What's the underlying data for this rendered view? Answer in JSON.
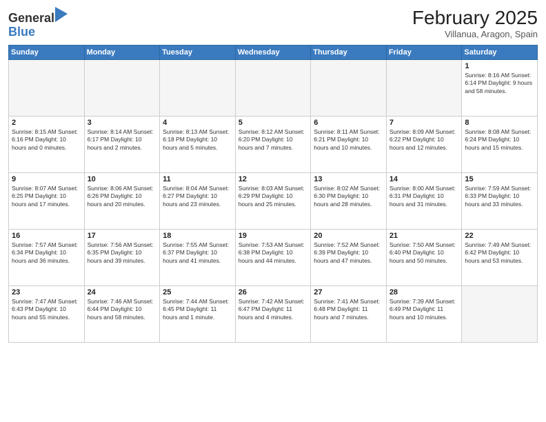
{
  "header": {
    "logo_general": "General",
    "logo_blue": "Blue",
    "month_title": "February 2025",
    "subtitle": "Villanua, Aragon, Spain"
  },
  "weekdays": [
    "Sunday",
    "Monday",
    "Tuesday",
    "Wednesday",
    "Thursday",
    "Friday",
    "Saturday"
  ],
  "weeks": [
    [
      {
        "day": "",
        "info": ""
      },
      {
        "day": "",
        "info": ""
      },
      {
        "day": "",
        "info": ""
      },
      {
        "day": "",
        "info": ""
      },
      {
        "day": "",
        "info": ""
      },
      {
        "day": "",
        "info": ""
      },
      {
        "day": "1",
        "info": "Sunrise: 8:16 AM\nSunset: 6:14 PM\nDaylight: 9 hours\nand 58 minutes."
      }
    ],
    [
      {
        "day": "2",
        "info": "Sunrise: 8:15 AM\nSunset: 6:16 PM\nDaylight: 10 hours\nand 0 minutes."
      },
      {
        "day": "3",
        "info": "Sunrise: 8:14 AM\nSunset: 6:17 PM\nDaylight: 10 hours\nand 2 minutes."
      },
      {
        "day": "4",
        "info": "Sunrise: 8:13 AM\nSunset: 6:18 PM\nDaylight: 10 hours\nand 5 minutes."
      },
      {
        "day": "5",
        "info": "Sunrise: 8:12 AM\nSunset: 6:20 PM\nDaylight: 10 hours\nand 7 minutes."
      },
      {
        "day": "6",
        "info": "Sunrise: 8:11 AM\nSunset: 6:21 PM\nDaylight: 10 hours\nand 10 minutes."
      },
      {
        "day": "7",
        "info": "Sunrise: 8:09 AM\nSunset: 6:22 PM\nDaylight: 10 hours\nand 12 minutes."
      },
      {
        "day": "8",
        "info": "Sunrise: 8:08 AM\nSunset: 6:24 PM\nDaylight: 10 hours\nand 15 minutes."
      }
    ],
    [
      {
        "day": "9",
        "info": "Sunrise: 8:07 AM\nSunset: 6:25 PM\nDaylight: 10 hours\nand 17 minutes."
      },
      {
        "day": "10",
        "info": "Sunrise: 8:06 AM\nSunset: 6:26 PM\nDaylight: 10 hours\nand 20 minutes."
      },
      {
        "day": "11",
        "info": "Sunrise: 8:04 AM\nSunset: 6:27 PM\nDaylight: 10 hours\nand 23 minutes."
      },
      {
        "day": "12",
        "info": "Sunrise: 8:03 AM\nSunset: 6:29 PM\nDaylight: 10 hours\nand 25 minutes."
      },
      {
        "day": "13",
        "info": "Sunrise: 8:02 AM\nSunset: 6:30 PM\nDaylight: 10 hours\nand 28 minutes."
      },
      {
        "day": "14",
        "info": "Sunrise: 8:00 AM\nSunset: 6:31 PM\nDaylight: 10 hours\nand 31 minutes."
      },
      {
        "day": "15",
        "info": "Sunrise: 7:59 AM\nSunset: 6:33 PM\nDaylight: 10 hours\nand 33 minutes."
      }
    ],
    [
      {
        "day": "16",
        "info": "Sunrise: 7:57 AM\nSunset: 6:34 PM\nDaylight: 10 hours\nand 36 minutes."
      },
      {
        "day": "17",
        "info": "Sunrise: 7:56 AM\nSunset: 6:35 PM\nDaylight: 10 hours\nand 39 minutes."
      },
      {
        "day": "18",
        "info": "Sunrise: 7:55 AM\nSunset: 6:37 PM\nDaylight: 10 hours\nand 41 minutes."
      },
      {
        "day": "19",
        "info": "Sunrise: 7:53 AM\nSunset: 6:38 PM\nDaylight: 10 hours\nand 44 minutes."
      },
      {
        "day": "20",
        "info": "Sunrise: 7:52 AM\nSunset: 6:39 PM\nDaylight: 10 hours\nand 47 minutes."
      },
      {
        "day": "21",
        "info": "Sunrise: 7:50 AM\nSunset: 6:40 PM\nDaylight: 10 hours\nand 50 minutes."
      },
      {
        "day": "22",
        "info": "Sunrise: 7:49 AM\nSunset: 6:42 PM\nDaylight: 10 hours\nand 53 minutes."
      }
    ],
    [
      {
        "day": "23",
        "info": "Sunrise: 7:47 AM\nSunset: 6:43 PM\nDaylight: 10 hours\nand 55 minutes."
      },
      {
        "day": "24",
        "info": "Sunrise: 7:46 AM\nSunset: 6:44 PM\nDaylight: 10 hours\nand 58 minutes."
      },
      {
        "day": "25",
        "info": "Sunrise: 7:44 AM\nSunset: 6:45 PM\nDaylight: 11 hours\nand 1 minute."
      },
      {
        "day": "26",
        "info": "Sunrise: 7:42 AM\nSunset: 6:47 PM\nDaylight: 11 hours\nand 4 minutes."
      },
      {
        "day": "27",
        "info": "Sunrise: 7:41 AM\nSunset: 6:48 PM\nDaylight: 11 hours\nand 7 minutes."
      },
      {
        "day": "28",
        "info": "Sunrise: 7:39 AM\nSunset: 6:49 PM\nDaylight: 11 hours\nand 10 minutes."
      },
      {
        "day": "",
        "info": ""
      }
    ]
  ]
}
